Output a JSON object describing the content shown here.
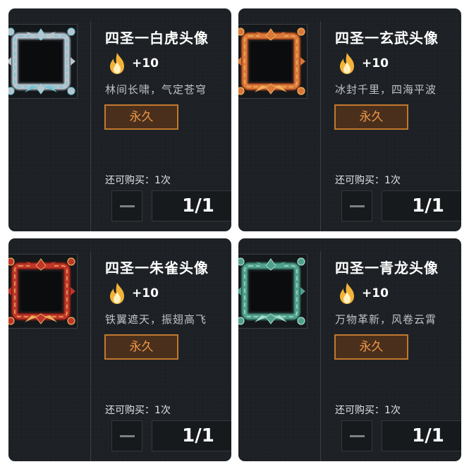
{
  "items": [
    {
      "title": "四圣一白虎头像",
      "points": "+10",
      "description": "林间长啸，气定苍穹",
      "duration": "永久",
      "remaining": "还可购买：1次",
      "quantity": "1/1",
      "icon": "silver-tiger-frame-icon",
      "colors": {
        "frame": "#b8c4cc",
        "accent": "#6fc6d6",
        "shade": "#5f6a72"
      }
    },
    {
      "title": "四圣一玄武头像",
      "points": "+10",
      "description": "冰封千里，四海平波",
      "duration": "永久",
      "remaining": "还可购买：1次",
      "quantity": "1/1",
      "icon": "orange-tortoise-frame-icon",
      "colors": {
        "frame": "#d9783a",
        "accent": "#f2b25c",
        "shade": "#8a3a1a"
      }
    },
    {
      "title": "四圣一朱雀头像",
      "points": "+10",
      "description": "铁翼遮天，振翅高飞",
      "duration": "永久",
      "remaining": "还可购买：1次",
      "quantity": "1/1",
      "icon": "crimson-phoenix-frame-icon",
      "colors": {
        "frame": "#c0352a",
        "accent": "#e8b25a",
        "shade": "#6e1a14"
      }
    },
    {
      "title": "四圣一青龙头像",
      "points": "+10",
      "description": "万物革新，风卷云霄",
      "duration": "永久",
      "remaining": "还可购买：1次",
      "quantity": "1/1",
      "icon": "teal-dragon-frame-icon",
      "colors": {
        "frame": "#4fa08c",
        "accent": "#a8dccb",
        "shade": "#2a5a50"
      }
    }
  ],
  "flame_color": "#f2b33a",
  "duration_color": "#f09a4a"
}
